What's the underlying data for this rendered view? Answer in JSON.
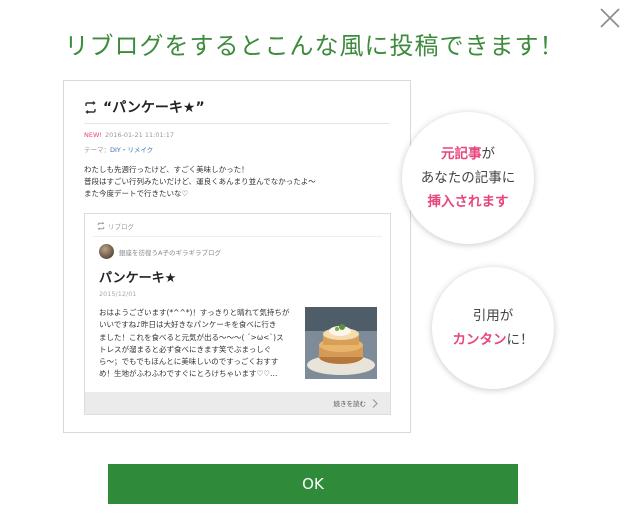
{
  "headline": "リブログをするとこんな風に投稿できます！",
  "preview": {
    "post_title": "“パンケーキ★”",
    "new_badge": "NEW!",
    "timestamp": "2016-01-21 11:01:17",
    "theme_label": "テーマ：",
    "theme_value": "DIY・リメイク",
    "body_lines": [
      "わたしも先週行ったけど、すごく美味しかった！",
      "普段はすごい行列みたいだけど、運良くあんまり並んでなかったよ〜",
      "また今度デートで行きたいな♡"
    ],
    "reblog_label": "リブログ",
    "author": "銀座を彷徨うA子のギラギラブログ",
    "card_title": "パンケーキ★",
    "card_date": "2015/12/01",
    "excerpt_lines": [
      "おはようございます(*^^*)！すっきりと晴れて気持ちが",
      "いいですね♪昨日は大好きなパンケーキを食べに行き",
      "ました！これを食べると元気が出る〜〜〜( ´>ω<`)ス",
      "トレスが溜まると必ず食べにきます笑でぶまっしぐ",
      "ら〜；でもでもほんとに美味しいのですっごくおすす",
      "め！生地がふわふわですぐにとろけちゃいます♡♡…"
    ],
    "read_more": "続きを読む"
  },
  "bubble_1": {
    "highlight": "元記事",
    "line1_suffix": "が",
    "line2": "あなたの記事に",
    "highlight2": "挿入されます"
  },
  "bubble_2": {
    "line1": "引用が",
    "highlight": "カンタン",
    "line2_suffix": "に！"
  },
  "ok_label": "OK",
  "colors": {
    "brand_green": "#3d8c3d",
    "button_green": "#2f8a3a",
    "accent_pink": "#e8457d"
  }
}
